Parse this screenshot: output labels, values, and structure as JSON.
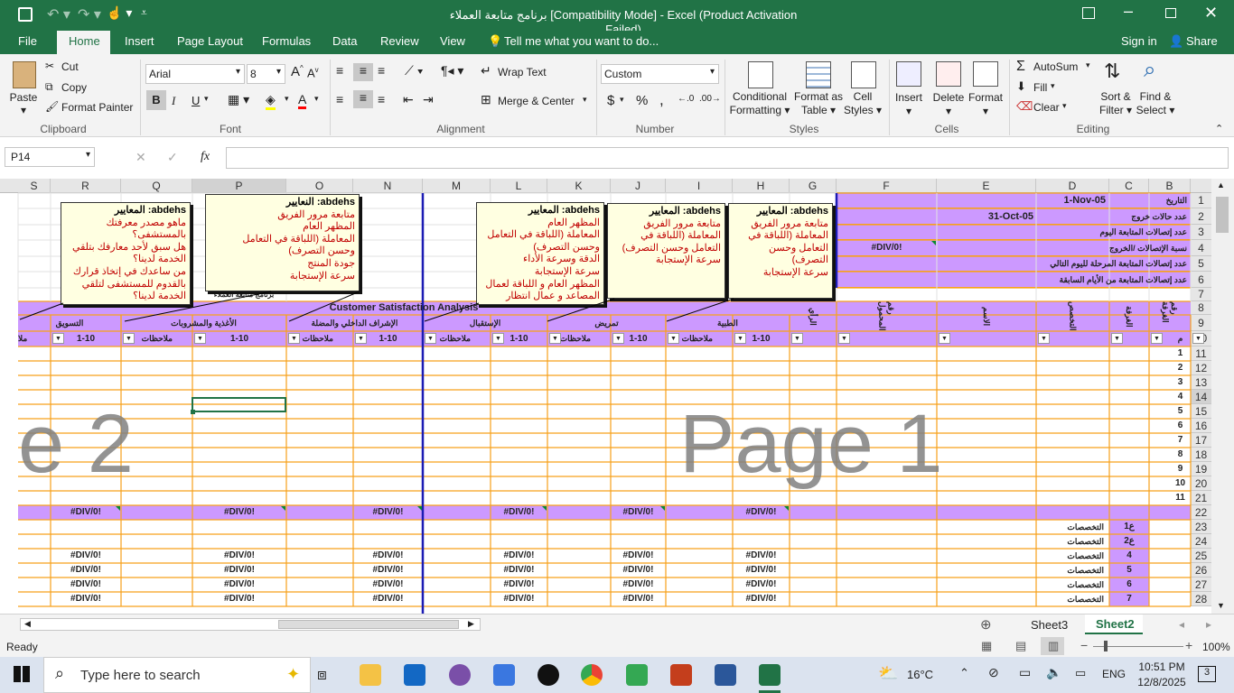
{
  "window": {
    "title": "برنامج متابعة العملاء  [Compatibility Mode] - Excel (Product Activation Failed)"
  },
  "tabs": [
    "File",
    "Home",
    "Insert",
    "Page Layout",
    "Formulas",
    "Data",
    "Review",
    "View"
  ],
  "tell_me": "Tell me what you want to do...",
  "account": {
    "sign_in": "Sign in",
    "share": "Share"
  },
  "clipboard": {
    "paste": "Paste",
    "cut": "Cut",
    "copy": "Copy",
    "format_painter": "Format Painter",
    "label": "Clipboard"
  },
  "font": {
    "name": "Arial",
    "size": "8",
    "label": "Font",
    "bold": "B",
    "italic": "I",
    "underline": "U"
  },
  "alignment": {
    "wrap": "Wrap Text",
    "merge": "Merge & Center",
    "label": "Alignment"
  },
  "number": {
    "format": "Custom",
    "label": "Number",
    "currency": "$",
    "percent": "%",
    "comma": ","
  },
  "styles": {
    "conditional": "Conditional",
    "conditional2": "Formatting",
    "format_as": "Format as",
    "format_as2": "Table",
    "cell": "Cell",
    "cell2": "Styles",
    "label": "Styles"
  },
  "cells": {
    "insert": "Insert",
    "delete": "Delete",
    "format": "Format",
    "label": "Cells"
  },
  "editing": {
    "autosum": "AutoSum",
    "fill": "Fill",
    "clear": "Clear",
    "sort": "Sort &",
    "sort2": "Filter",
    "find": "Find &",
    "find2": "Select",
    "label": "Editing"
  },
  "name_box": "P14",
  "fx": "fx",
  "columns": [
    "S",
    "R",
    "Q",
    "P",
    "O",
    "N",
    "M",
    "L",
    "K",
    "J",
    "I",
    "H",
    "G",
    "F",
    "E",
    "D",
    "C",
    "B",
    "A"
  ],
  "rows": [
    "1",
    "2",
    "3",
    "4",
    "5",
    "6",
    "7",
    "8",
    "9",
    "10",
    "11",
    "12",
    "13",
    "14",
    "15",
    "16",
    "17",
    "18",
    "19",
    "20",
    "21",
    "22",
    "23",
    "24",
    "25",
    "26",
    "27",
    "28"
  ],
  "sheet": {
    "r1_label": "التاريخ",
    "r1_value": "1-Nov-05",
    "r2_label": "عدد حالات خروج",
    "r2_value": "31-Oct-05",
    "r3_label": "عدد إتصالات المتابعة اليوم",
    "r4_label": "نسبة الإتصالات /الخروج",
    "r4_value": "#DIV/0!",
    "r5_label": "عدد إتصالات المتابعة المرحلة لليوم التالي",
    "r6_label": "عدد إتصالات المتابعة من الأيام السابقة",
    "analysis_title": "Customer Satisfaction Analysis",
    "header_tiny": "برنامج متابعة العملاء",
    "groups": [
      "الطبية",
      "تمريض",
      "الإستقبال",
      "الإشراف الداخلي والمضلة",
      "الأغذية والمشروبات",
      "التسويق"
    ],
    "col_heads": {
      "g": "الرأي",
      "f": "رقم المحمول",
      "e": "الاسم",
      "d": "التخصص",
      "c": "الغرفة",
      "b": "رقم الغرفة",
      "a": "م"
    },
    "sub_rating": "1-10",
    "sub_notes": "ملاحظات",
    "sub_notes_short": "ملا",
    "row_nums": [
      "1",
      "2",
      "3",
      "4",
      "5",
      "6",
      "7",
      "8",
      "9",
      "10",
      "11"
    ],
    "div": "#DIV/0!",
    "spec": "التخصصات",
    "codes": [
      "ع1",
      "ع2",
      "4",
      "5",
      "6",
      "7"
    ],
    "page1": "Page 1",
    "page2": "e 2"
  },
  "comments": {
    "c1": {
      "title": "abdehs: المعايير",
      "lines": [
        "ماهو مصدر معرفتك",
        "بالمستشفى؟",
        "هل سبق لأحد معارفك بتلقي",
        "الخدمة لدينا؟",
        "من ساعدك في إتخاذ قرارك",
        "بالقدوم للمستشفى لتلقي",
        "الخدمة لدينا؟"
      ]
    },
    "c2": {
      "title": "abdehs: النعايير",
      "lines": [
        "متابعة مرور الفريق",
        "المظهر العام",
        "المعاملة (اللباقة في التعامل",
        "وحسن التصرف)",
        "جودة المنتج",
        "سرعة الإستجابة"
      ]
    },
    "c3": {
      "title": "abdehs: المعايير",
      "lines": [
        "المظهر العام",
        "المعاملة (اللباقة في التعامل",
        "وحسن التصرف)",
        "الدقة وسرعة الأداء",
        "سرعة الإستجابة",
        "المظهر العام و اللباقة لعمال",
        "المصاعد و عمال انتظار"
      ]
    },
    "c4": {
      "title": "abdehs: المعايير",
      "lines": [
        "متابعة مرور الفريق",
        "المعاملة (اللباقة في",
        "التعامل وحسن التصرف)",
        "سرعة الإستجابة"
      ]
    },
    "c5": {
      "title": "abdehs: المعايير",
      "lines": [
        "متابعة مرور الفريق",
        "المعاملة (اللباقة في",
        "التعامل وحسن التصرف)",
        "سرعة الإستجابة"
      ]
    }
  },
  "sheet_tabs": [
    "Sheet3",
    "Sheet2"
  ],
  "status": {
    "ready": "Ready",
    "zoom": "100%"
  },
  "taskbar": {
    "search": "Type here to search",
    "weather": "16°C",
    "lang": "ENG",
    "time": "10:51 PM",
    "date": "12/8/2025",
    "notif": "3"
  },
  "colors": {
    "excel_green": "#217346",
    "header_purple": "#cc99ff",
    "border_orange": "#f7a11a",
    "page_break": "#1c1cb4"
  }
}
